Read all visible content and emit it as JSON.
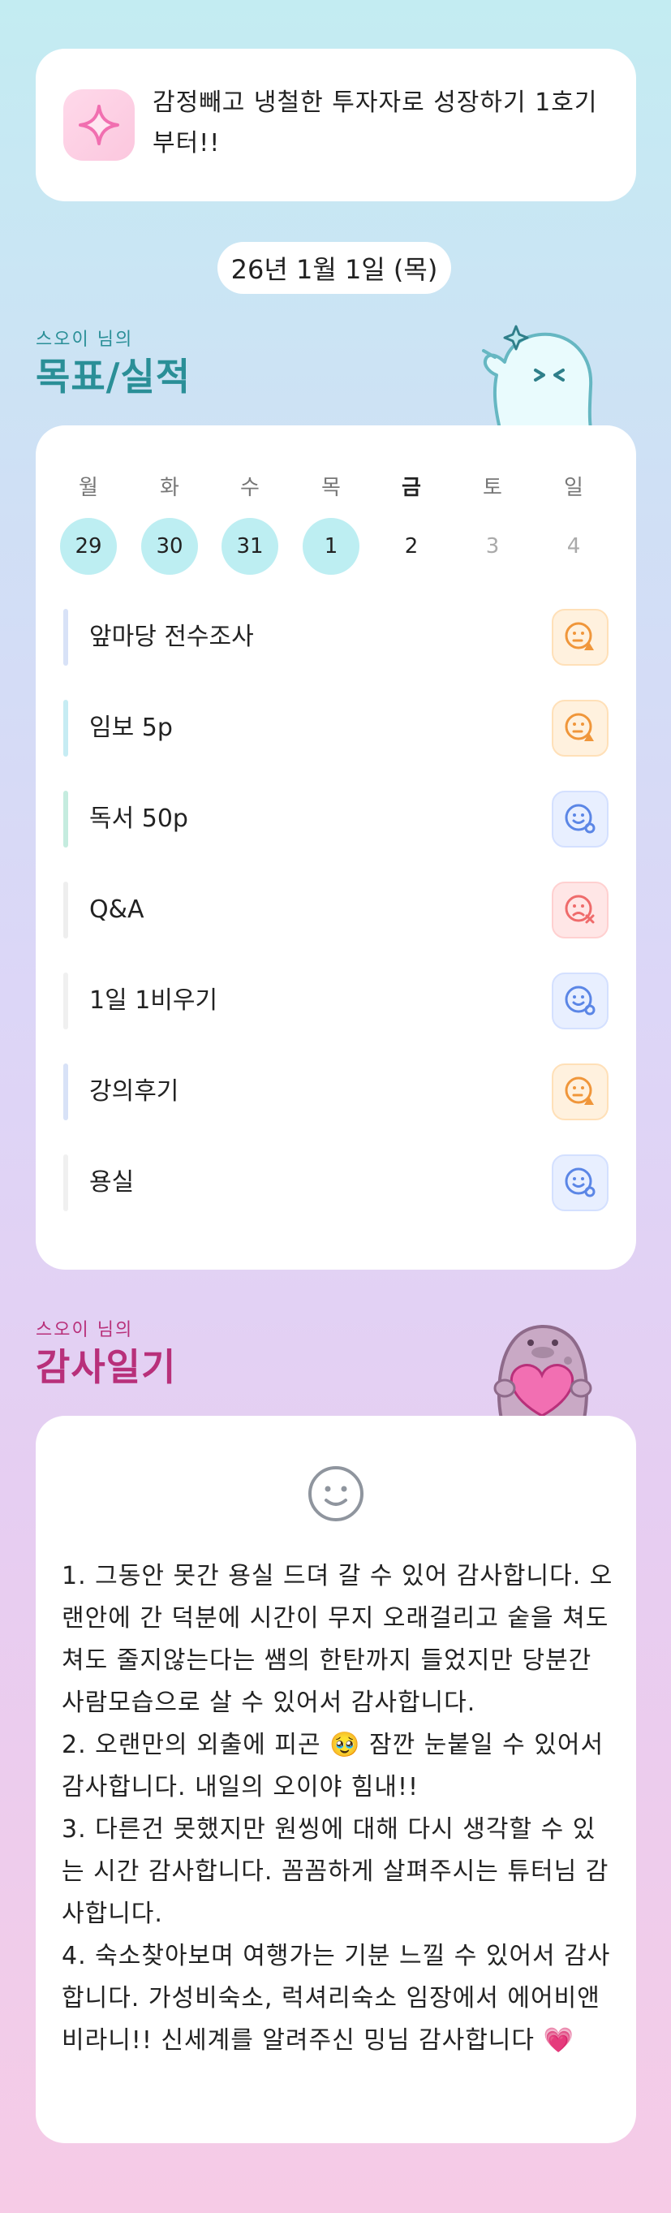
{
  "top": {
    "message": "감정빼고 냉철한 투자자로 성장하기 1호기부터!!",
    "icon": "sparkle-icon"
  },
  "date": "26년 1월 1일 (목)",
  "goals_section": {
    "owner": "스오이 님의",
    "title": "목표/실적",
    "mascot": "ghost-mascot"
  },
  "calendar": {
    "weekdays": [
      "월",
      "화",
      "수",
      "목",
      "금",
      "토",
      "일"
    ],
    "dates": [
      "29",
      "30",
      "31",
      "1",
      "2",
      "3",
      "4"
    ]
  },
  "goals": [
    {
      "label": "앞마당 전수조사",
      "status": "warning",
      "icon": "face-warning-icon",
      "bar_color": "#d8e2f7"
    },
    {
      "label": "임보 5p",
      "status": "warning",
      "icon": "face-warning-icon",
      "bar_color": "#c6ecf3"
    },
    {
      "label": "독서 50p",
      "status": "done",
      "icon": "face-check-icon",
      "bar_color": "#c5ecdf"
    },
    {
      "label": "Q&A",
      "status": "failed",
      "icon": "face-x-icon",
      "bar_color": "#eeeeee"
    },
    {
      "label": "1일 1비우기",
      "status": "done",
      "icon": "face-check-icon",
      "bar_color": "#f0f0f0"
    },
    {
      "label": "강의후기",
      "status": "warning",
      "icon": "face-warning-icon",
      "bar_color": "#d8e2f7"
    },
    {
      "label": "용실",
      "status": "done",
      "icon": "face-check-icon",
      "bar_color": "#f0f0f0"
    }
  ],
  "gratitude_section": {
    "owner": "스오이 님의",
    "title": "감사일기",
    "mascot": "blob-heart-mascot",
    "mood_icon": "smiley-icon"
  },
  "gratitude_text": "1. 그동안 못간 용실 드뎌 갈 수 있어 감사합니다. 오랜안에 간 덕분에 시간이 무지 오래걸리고 숱을 쳐도쳐도 줄지않는다는 쌤의 한탄까지 들었지만 당분간 사람모습으로 살 수 있어서 감사합니다.\n2. 오랜만의 외출에 피곤 🥹 잠깐 눈붙일 수 있어서 감사합니다. 내일의 오이야 힘내!!\n3. 다른건 못했지만 원씽에 대해 다시 생각할 수 있는 시간 감사합니다. 꼼꼼하게 살펴주시는 튜터님 감사합니다.\n4. 숙소찾아보며 여행가는 기분 느낄 수 있어서 감사합니다. 가성비숙소, 럭셔리숙소 임장에서 에어비앤비라니!! 신세계를 알려주신 밍님 감사합니다 💗",
  "colors": {
    "teal": "#2a8f97",
    "magenta": "#b8307a",
    "orange": "#f0963a",
    "blue": "#5b86e6",
    "red": "#ef6b6b",
    "date_highlight": "#bdeef2"
  }
}
